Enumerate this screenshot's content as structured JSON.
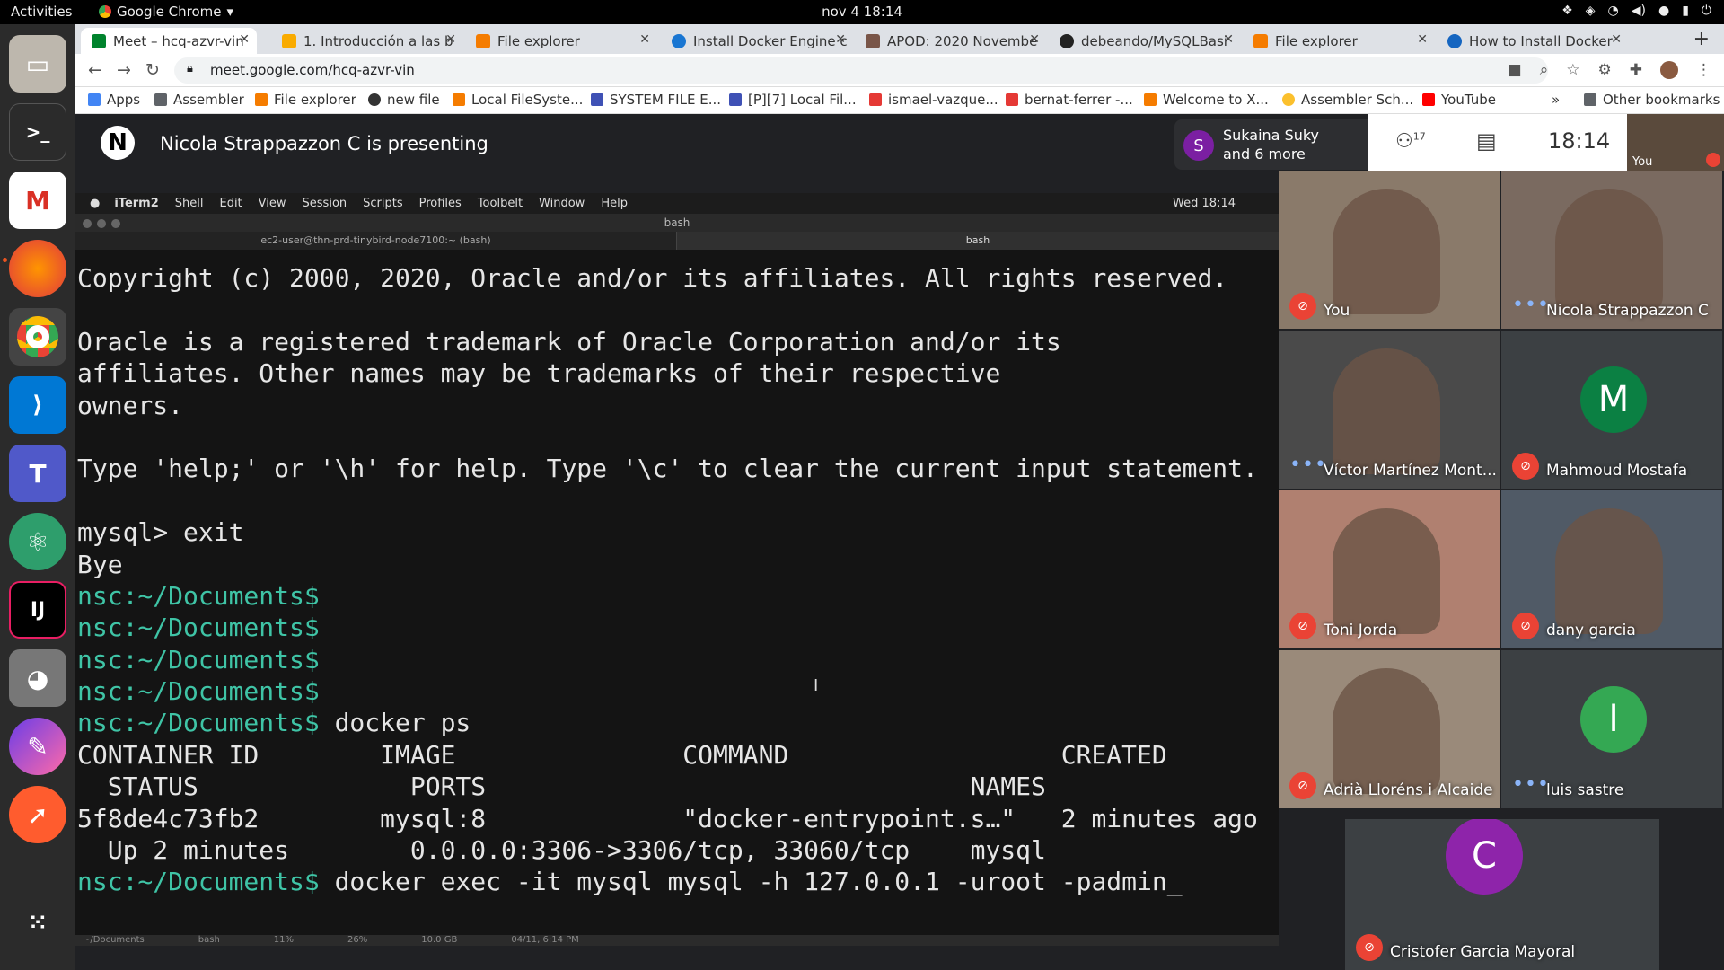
{
  "os": {
    "activities": "Activities",
    "app_name": "Google Chrome",
    "clock": "nov 4  18:14"
  },
  "tabs": [
    {
      "title": "Meet – hcq-azvr-vin",
      "color": "#1a73e8",
      "active": true
    },
    {
      "title": "1. Introducción a las b",
      "color": "#f9ab00"
    },
    {
      "title": "File explorer",
      "color": "#f57c00"
    },
    {
      "title": "Install Docker Engine c",
      "color": "#1976d2"
    },
    {
      "title": "APOD: 2020 Novembe",
      "color": "#795548"
    },
    {
      "title": "debeando/MySQLBasi",
      "color": "#222222"
    },
    {
      "title": "File explorer",
      "color": "#f57c00"
    },
    {
      "title": "How to Install Docker",
      "color": "#1565c0"
    }
  ],
  "address": {
    "url": "meet.google.com/hcq-azvr-vin"
  },
  "bookmarks": [
    {
      "label": "Apps",
      "color": "#4285f4"
    },
    {
      "label": "Assembler",
      "color": "#5f6368"
    },
    {
      "label": "File explorer",
      "color": "#f57c00"
    },
    {
      "label": "new file",
      "color": "#333333"
    },
    {
      "label": "Local FileSyste...",
      "color": "#f57c00"
    },
    {
      "label": "SYSTEM FILE E...",
      "color": "#3f51b5"
    },
    {
      "label": "[P][7] Local Fil...",
      "color": "#3f51b5"
    },
    {
      "label": "ismael-vazque...",
      "color": "#e53935"
    },
    {
      "label": "bernat-ferrer -...",
      "color": "#e53935"
    },
    {
      "label": "Welcome to X...",
      "color": "#f57c00"
    },
    {
      "label": "Assembler Sch...",
      "color": "#fbc02d"
    },
    {
      "label": "YouTube",
      "color": "#ff0000"
    }
  ],
  "other_bookmarks": "Other bookmarks",
  "meet": {
    "presenter_initial": "N",
    "presenting_text": "Nicola Strappazzon C is presenting",
    "chip_initial": "S",
    "chip_line1": "Sukaina Suky",
    "chip_line2": "and 6 more",
    "participant_count": "17",
    "time": "18:14",
    "self_label": "You"
  },
  "shared_screen": {
    "menu": [
      "iTerm2",
      "Shell",
      "Edit",
      "View",
      "Session",
      "Scripts",
      "Profiles",
      "Toolbelt",
      "Window",
      "Help"
    ],
    "mac_clock": "Wed 18:14",
    "window_title": "bash",
    "tab1": "ec2-user@thn-prd-tinybird-node7100:~ (bash)",
    "tab2": "bash",
    "terminal_lines": [
      {
        "prompt": "",
        "text": "Copyright (c) 2000, 2020, Oracle and/or its affiliates. All rights reserved."
      },
      {
        "prompt": "",
        "text": ""
      },
      {
        "prompt": "",
        "text": "Oracle is a registered trademark of Oracle Corporation and/or its"
      },
      {
        "prompt": "",
        "text": "affiliates. Other names may be trademarks of their respective"
      },
      {
        "prompt": "",
        "text": "owners."
      },
      {
        "prompt": "",
        "text": ""
      },
      {
        "prompt": "",
        "text": "Type 'help;' or '\\h' for help. Type '\\c' to clear the current input statement."
      },
      {
        "prompt": "",
        "text": ""
      },
      {
        "prompt": "",
        "text": "mysql> exit"
      },
      {
        "prompt": "",
        "text": "Bye"
      },
      {
        "prompt": "nsc:~/Documents$",
        "text": ""
      },
      {
        "prompt": "nsc:~/Documents$",
        "text": ""
      },
      {
        "prompt": "nsc:~/Documents$",
        "text": ""
      },
      {
        "prompt": "nsc:~/Documents$",
        "text": ""
      },
      {
        "prompt": "nsc:~/Documents$",
        "text": " docker ps"
      },
      {
        "prompt": "",
        "text": "CONTAINER ID        IMAGE               COMMAND                  CREATED"
      },
      {
        "prompt": "",
        "text": "  STATUS              PORTS                                NAMES"
      },
      {
        "prompt": "",
        "text": "5f8de4c73fb2        mysql:8             \"docker-entrypoint.s…\"   2 minutes ago"
      },
      {
        "prompt": "",
        "text": "  Up 2 minutes        0.0.0.0:3306->3306/tcp, 33060/tcp    mysql"
      },
      {
        "prompt": "nsc:~/Documents$",
        "text": " docker exec -it mysql mysql -h 127.0.0.1 -uroot -padmin_"
      }
    ],
    "status": [
      "~/Documents",
      "bash",
      "11%",
      "26%",
      "10.0 GB",
      "04/11, 6:14 PM"
    ]
  },
  "participants": [
    {
      "name": "You",
      "muted": true,
      "type": "video",
      "bg": "#8a7a6a"
    },
    {
      "name": "Nicola Strappazzon C",
      "muted": false,
      "type": "video",
      "bg": "#7a6a60"
    },
    {
      "name": "Víctor Martínez Mont...",
      "muted": false,
      "type": "video",
      "bg": "#4a4a4a"
    },
    {
      "name": "Mahmoud Mostafa",
      "muted": true,
      "type": "avatar",
      "initial": "M",
      "color": "#0b8043"
    },
    {
      "name": "Toni Jorda",
      "muted": true,
      "type": "video",
      "bg": "#b08070"
    },
    {
      "name": "dany garcia",
      "muted": true,
      "type": "video",
      "bg": "#505a66"
    },
    {
      "name": "Adrià Lloréns i Alcaide",
      "muted": true,
      "type": "video",
      "bg": "#9a8a7a"
    },
    {
      "name": "luis sastre",
      "muted": false,
      "type": "avatar",
      "initial": "l",
      "color": "#34a853"
    },
    {
      "name": "Cristofer Garcia Mayoral",
      "muted": true,
      "type": "avatar",
      "initial": "C",
      "color": "#8e24aa"
    }
  ]
}
